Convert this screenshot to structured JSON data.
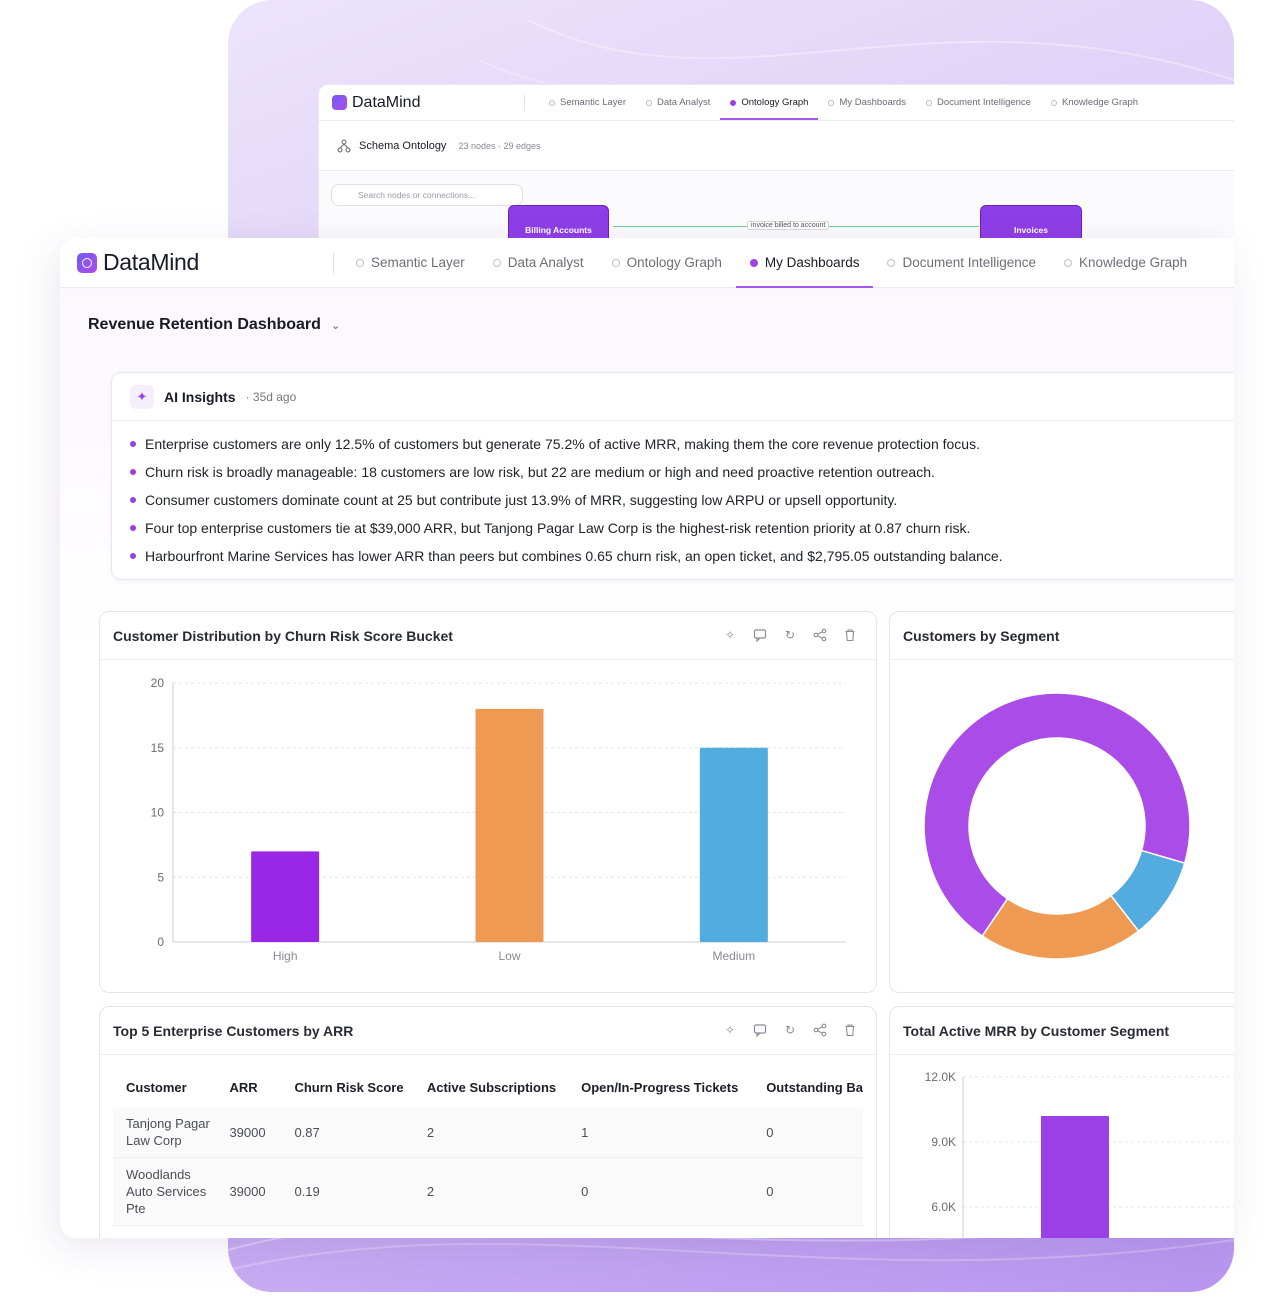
{
  "brand": {
    "name_a": "Data",
    "name_b": "Mind"
  },
  "nav_tabs": [
    {
      "label": "Semantic Layer",
      "active": false
    },
    {
      "label": "Data Analyst",
      "active": false
    },
    {
      "label": "Ontology Graph",
      "active": false
    },
    {
      "label": "My Dashboards",
      "active": true
    },
    {
      "label": "Document Intelligence",
      "active": false
    },
    {
      "label": "Knowledge Graph",
      "active": false
    }
  ],
  "back_window": {
    "active_tab": "Ontology Graph",
    "header_title": "Schema Ontology",
    "header_meta": "23 nodes · 29 edges",
    "search_placeholder": "Search nodes or connections...",
    "nodes": [
      {
        "label": "Billing Accounts"
      },
      {
        "label": "Invoices"
      }
    ],
    "edge_label": "invoice billed to account"
  },
  "dashboard": {
    "title": "Revenue Retention Dashboard"
  },
  "insights": {
    "title": "AI Insights",
    "time": "· 35d ago",
    "items": [
      "Enterprise customers are only 12.5% of customers but generate 75.2% of active MRR, making them the core revenue protection focus.",
      "Churn risk is broadly manageable: 18 customers are low risk, but 22 are medium or high and need proactive retention outreach.",
      "Consumer customers dominate count at 25 but contribute just 13.9% of MRR, suggesting low ARPU or upsell opportunity.",
      "Four top enterprise customers tie at $39,000 ARR, but Tanjong Pagar Law Corp is the highest-risk retention priority at 0.87 churn risk.",
      "Harbourfront Marine Services has lower ARR than peers but combines 0.65 churn risk, an open ticket, and $2,795.05 outstanding balance."
    ]
  },
  "panels": {
    "churn": {
      "title": "Customer Distribution by Churn Risk Score Bucket"
    },
    "segment": {
      "title": "Customers by Segment"
    },
    "top5": {
      "title": "Top 5 Enterprise Customers by ARR"
    },
    "mrr": {
      "title": "Total Active MRR by Customer Segment"
    }
  },
  "table": {
    "columns": [
      "Customer",
      "ARR",
      "Churn Risk Score",
      "Active Subscriptions",
      "Open/In-Progress Tickets",
      "Outstanding Ba"
    ],
    "rows": [
      [
        "Tanjong Pagar Law Corp",
        "39000",
        "0.87",
        "2",
        "1",
        "0"
      ],
      [
        "Woodlands Auto Services Pte",
        "39000",
        "0.19",
        "2",
        "0",
        "0"
      ]
    ]
  },
  "colors": {
    "purple": "#9b27e6",
    "orange": "#ef9a52",
    "blue": "#52ace0",
    "accent": "#a455ea"
  },
  "chart_data": [
    {
      "type": "bar",
      "categories": [
        "High",
        "Low",
        "Medium"
      ],
      "values": [
        7,
        18,
        15
      ],
      "colors": [
        "#9b27e6",
        "#ef9a52",
        "#52ace0"
      ],
      "ylim": [
        0,
        20
      ],
      "yticks": [
        "0",
        "5",
        "10",
        "15",
        "20"
      ],
      "grid": true
    },
    {
      "type": "pie",
      "donut": true,
      "values": [
        70,
        10,
        20
      ],
      "colors": [
        "#aa4de8",
        "#52ace0",
        "#ef9a52"
      ]
    },
    {
      "type": "bar",
      "values": [
        10200
      ],
      "colors": [
        "#9b3fe6"
      ],
      "ylim_visible": [
        6000,
        12000
      ],
      "yticks": [
        "6.0K",
        "9.0K",
        "12.0K"
      ],
      "grid": true
    }
  ]
}
